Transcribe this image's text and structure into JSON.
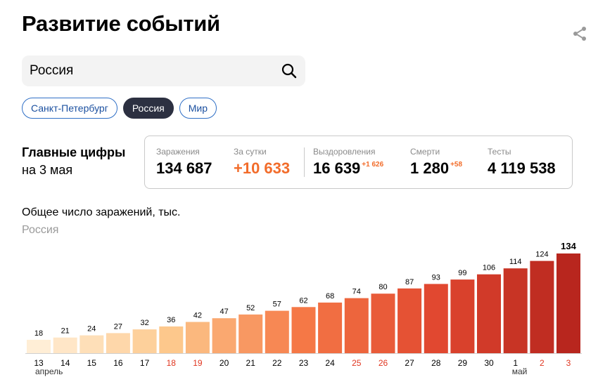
{
  "header": {
    "title": "Развитие событий",
    "share_icon": "share-icon"
  },
  "search": {
    "value": "Россия",
    "icon": "search-icon"
  },
  "chips": [
    {
      "label": "Санкт-Петербург",
      "active": false
    },
    {
      "label": "Россия",
      "active": true
    },
    {
      "label": "Мир",
      "active": false
    }
  ],
  "main": {
    "title": "Главные цифры",
    "date": "на 3 мая"
  },
  "stats": [
    {
      "label": "Заражения",
      "value": "134 687",
      "delta": ""
    },
    {
      "label": "За сутки",
      "value": "+10 633",
      "delta": ""
    },
    {
      "label": "Выздоровления",
      "value": "16 639",
      "delta": "+1 626"
    },
    {
      "label": "Смерти",
      "value": "1 280",
      "delta": "+58"
    },
    {
      "label": "Тесты",
      "value": "4 119 538",
      "delta": ""
    }
  ],
  "colors": {
    "accent_orange": "#f26c2a",
    "weekend_red": "#e0351f",
    "chip_active": "#2c3041",
    "chip_border": "#2f6fc6"
  },
  "chart_data": {
    "type": "bar",
    "title": "Общее число заражений, тыс.",
    "subtitle": "Россия",
    "categories": [
      "13",
      "14",
      "15",
      "16",
      "17",
      "18",
      "19",
      "20",
      "21",
      "22",
      "23",
      "24",
      "25",
      "26",
      "27",
      "28",
      "29",
      "30",
      "1",
      "2",
      "3"
    ],
    "values": [
      18,
      21,
      24,
      27,
      32,
      36,
      42,
      47,
      52,
      57,
      62,
      68,
      74,
      80,
      87,
      93,
      99,
      106,
      114,
      124,
      134
    ],
    "weekend_categories": [
      "18",
      "19",
      "25",
      "26",
      "2",
      "3"
    ],
    "month_labels": [
      {
        "label": "апрель",
        "at": "13"
      },
      {
        "label": "май",
        "at": "1"
      }
    ],
    "highlighted_last_value": true,
    "ylim": [
      0,
      134
    ],
    "grid": false
  }
}
